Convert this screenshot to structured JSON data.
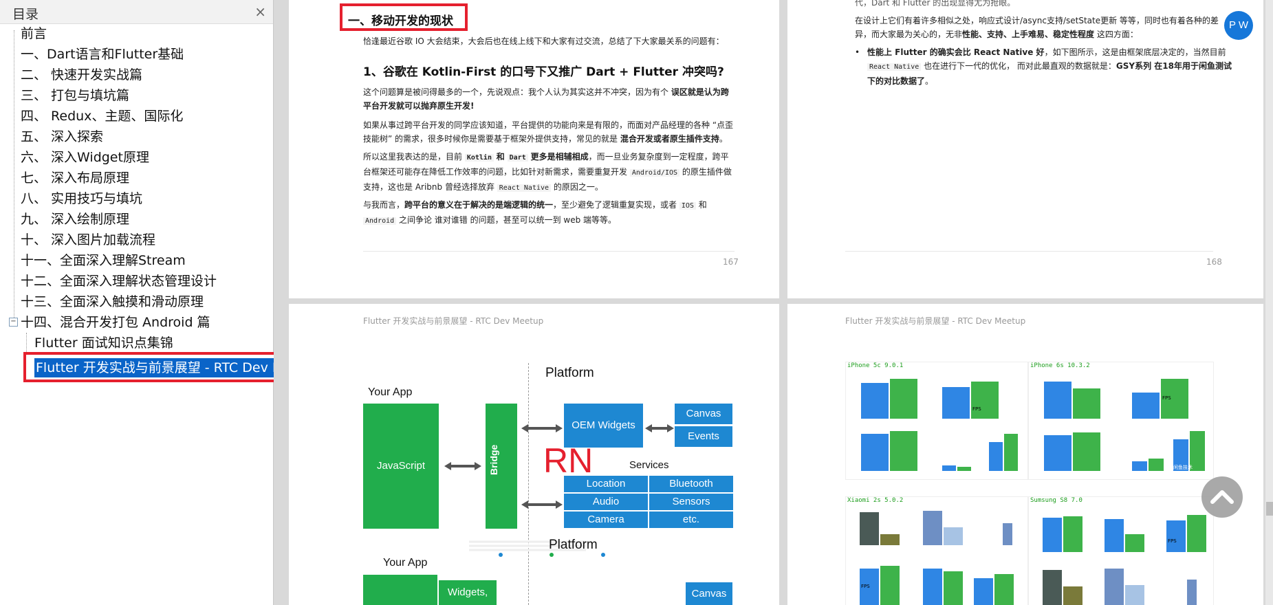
{
  "sidebar": {
    "title": "目录",
    "close_label": "×",
    "items": [
      {
        "label": "前言",
        "level": 0
      },
      {
        "label": "一、Dart语言和Flutter基础",
        "level": 0
      },
      {
        "label": "二、 快速开发实战篇",
        "level": 0
      },
      {
        "label": "三、 打包与填坑篇",
        "level": 0
      },
      {
        "label": "四、 Redux、主题、国际化",
        "level": 0
      },
      {
        "label": "五、 深入探索",
        "level": 0
      },
      {
        "label": "六、 深入Widget原理",
        "level": 0
      },
      {
        "label": "七、 深入布局原理",
        "level": 0
      },
      {
        "label": "八、 实用技巧与填坑",
        "level": 0
      },
      {
        "label": "九、 深入绘制原理",
        "level": 0
      },
      {
        "label": "十、 深入图片加载流程",
        "level": 0
      },
      {
        "label": "十一、全面深入理解Stream",
        "level": 0
      },
      {
        "label": "十二、全面深入理解状态管理设计",
        "level": 0
      },
      {
        "label": "十三、全面深入触摸和滑动原理",
        "level": 0
      },
      {
        "label": "十四、混合开发打包 Android 篇",
        "level": 0
      },
      {
        "label": "Flutter 面试知识点集锦",
        "level": 1
      },
      {
        "label": "Flutter 开发实战与前景展望 - RTC Dev Meetup",
        "level": 1,
        "selected": true
      }
    ],
    "expander": "−"
  },
  "page167": {
    "heading": "一、移动开发的现状",
    "intro": "恰逢最近谷歌 IO 大会结束，大会后也在线上线下和大家有过交流，总结了下大家最关系的问题有：",
    "q1": "1、谷歌在 Kotlin-First 的口号下又推广 Dart + Flutter 冲突吗?",
    "para1_a": "这个问题算是被问得最多的一个，先说观点：我个人认为其实这并不冲突，因为有个",
    "para1_b": "误区就是认为跨平台开发就可以抛弃原生开发!",
    "para2_a": "如果从事过跨平台开发的同学应该知道，平台提供的功能向来是有限的，而面对产品经理的各种 “点歪技能树” 的需求，很多时候你是需要基于框架外提供支持，常见的就是",
    "para2_b": "混合开发或者原生插件支持",
    "para2_c": "。",
    "para3_a": "所以这里我表达的是，目前",
    "para3_kotlin": "Kotlin",
    "para3_and": "和",
    "para3_dart": "Dart",
    "para3_b": "更多是相辅相成",
    "para3_c": "，而一旦业务复杂度到一定程度，跨平台框架还可能存在降低工作效率的问题，比如针对新需求，需要重复开发",
    "para3_code": "Android/IOS",
    "para3_d": "的原生插件做支持，这也是 Aribnb 曾经选择放弃",
    "para3_rn": "React Native",
    "para3_e": "的原因之一。",
    "para4_a": "与我而言，",
    "para4_b": "跨平台的意义在于解决的是端逻辑的统一",
    "para4_c": "，至少避免了逻辑重复实现，或者",
    "para4_ios": "IOS",
    "para4_and": "和",
    "para4_android": "Android",
    "para4_d": "之间争论 谁对谁错 的问题，甚至可以统一到 web 端等等。",
    "page_number": "167"
  },
  "page168": {
    "top_line": "代，Dart 和 Flutter 的出现显得尤为抢眼。",
    "para1": "在设计上它们有着许多相似之处，响应式设计/async支持/setState更新 等等，同时也有着各种的差异，而大家最为关心的，无非",
    "para1_bold": "性能、支持、上手难易、稳定性程度",
    "para1_end": "这四方面：",
    "bullet_bold": "性能上 Flutter 的确实会比 React Native 好",
    "bullet_a": "，如下图所示，这是由框架底层决定的，当然目前",
    "bullet_code": "React Native",
    "bullet_b": "也在进行下一代的优化， 而对此最直观的数据就是：",
    "bullet_c": "GSY系列 在18年用于闲鱼测试下的对比数据了",
    "bullet_d": "。",
    "page_number": "168"
  },
  "page169": {
    "running_header": "Flutter 开发实战与前景展望 - RTC Dev Meetup",
    "diagram": {
      "platform_top": "Platform",
      "your_app_top": "Your App",
      "javascript": "JavaScript",
      "bridge": "Bridge",
      "oem_widgets": "OEM Widgets",
      "canvas": "Canvas",
      "events": "Events",
      "rn": "RN",
      "services": "Services",
      "svc": [
        "Location",
        "Bluetooth",
        "Audio",
        "Sensors",
        "Camera",
        "etc."
      ],
      "platform_bottom": "Platform",
      "your_app_bottom": "Your App",
      "widgets": "Widgets,",
      "canvas_bottom": "Canvas"
    }
  },
  "page170": {
    "running_header": "Flutter 开发实战与前景展望 - RTC Dev Meetup",
    "thumbs": [
      "iPhone 5c 9.0.1",
      "iPhone 6s 10.3.2",
      "Xiaomi 2s 5.0.2",
      "Sumsung S8 7.0"
    ],
    "fps": "FPS",
    "watermark": "闲鱼技术"
  },
  "floating": {
    "pw_label": "P W",
    "back_to_top": "back-to-top"
  },
  "colors": {
    "accent_red": "#e5202e",
    "selection_blue": "#0a64c8",
    "green": "#21ad4c",
    "blue": "#1e88d2"
  }
}
